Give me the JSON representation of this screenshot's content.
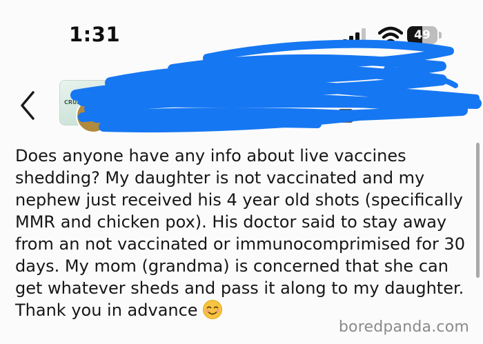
{
  "status_bar": {
    "time": "1:31",
    "battery_level": "49",
    "icons": [
      "signal-icon",
      "wifi-icon",
      "battery-icon"
    ]
  },
  "post": {
    "header": {
      "icons": [
        "back-chevron-icon",
        "group-avatar",
        "user-avatar",
        "privacy-icon"
      ],
      "group_avatar_text": "CRUNCH"
    },
    "body_lines": [
      "Does anyone have any info about live vaccines",
      "shedding? My daughter is not vaccinated and my",
      "nephew just received his 4 year old shots (specifically",
      "MMR and chicken pox). His doctor  said to stay away",
      "from an not vaccinated or immunocomprimised for 30",
      "days. My mom (grandma) is concerned that she can",
      "get whatever sheds and pass it along to my daughter.",
      "Thank you in advance"
    ],
    "emoji": "smiling-face-icon"
  },
  "watermark": "boredpanda.com",
  "colors": {
    "redaction": "#1677f2",
    "battery_fill": "#151515",
    "battery_track": "#bdbdbd",
    "text": "#161616",
    "avatar": "#b28a3e"
  }
}
